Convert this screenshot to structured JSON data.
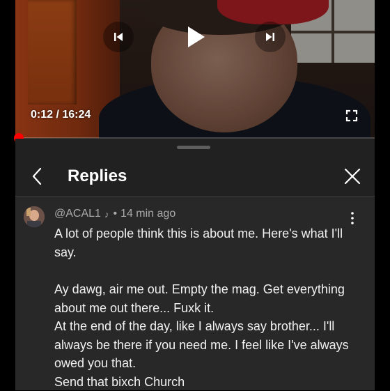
{
  "player": {
    "current_time": "0:12",
    "separator": " / ",
    "duration": "16:24",
    "progress": 0.012,
    "accent_color": "#ff0000",
    "icons": {
      "previous": "skip-previous-icon",
      "play": "play-icon",
      "next": "skip-next-icon",
      "fullscreen": "fullscreen-icon"
    }
  },
  "replies_panel": {
    "title": "Replies",
    "icons": {
      "back": "chevron-left-icon",
      "close": "close-icon"
    },
    "comment": {
      "author": "@ACAL1",
      "author_badge_icon": "music-note-icon",
      "dot": "•",
      "timestamp": "14 min ago",
      "more_icon": "more-vertical-icon",
      "lines": [
        "A lot of people think this is about me. Here's what I'll say.",
        "Ay dawg, air me out. Empty the mag. Get everything about me out there... Fuxk it.",
        "At the end of the day, like I always say brother... I'll always be there if you need me. I feel like I've always owed you that.",
        "Send that bixch Church"
      ]
    }
  }
}
